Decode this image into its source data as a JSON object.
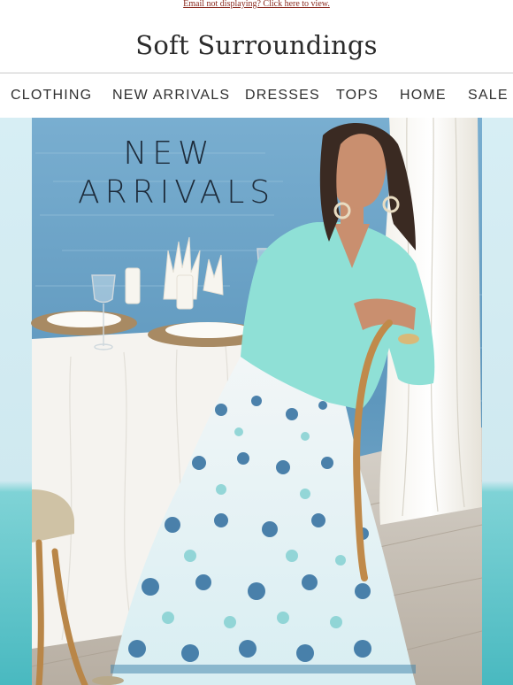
{
  "preheader": {
    "link_text": "Email not displaying? Click here to view."
  },
  "brand": {
    "name": "Soft Surroundings"
  },
  "nav": {
    "items": [
      "CLOTHING",
      "NEW ARRIVALS",
      "DRESSES",
      "TOPS",
      "HOME",
      "SALE"
    ]
  },
  "hero": {
    "line1": "NEW",
    "line2": "ARRIVALS"
  },
  "colors": {
    "link": "#8a2a1e",
    "text": "#2f2f2f",
    "sea": "#5f9cc1",
    "aqua_top": "#8fe0d6"
  }
}
